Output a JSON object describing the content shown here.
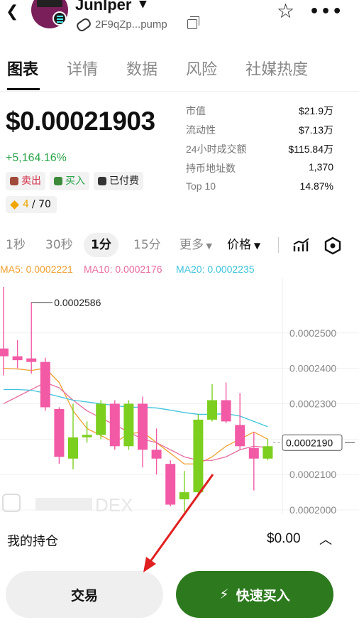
{
  "header": {
    "title": "JunIper",
    "address": "2F9qZp...pump",
    "icons": [
      "back-icon",
      "star-icon",
      "more-icon",
      "copy-icon",
      "pill-icon"
    ]
  },
  "tabs": [
    "图表",
    "详情",
    "数据",
    "风险",
    "社媒热度"
  ],
  "price": {
    "value": "$0.00021903",
    "change": "+5,164.16%"
  },
  "tags": {
    "sell": "卖出",
    "buy": "买入",
    "paid": "已付费",
    "rank": "4",
    "rank_total": "/ 70"
  },
  "stats": [
    {
      "k": "市值",
      "v": "$21.9万"
    },
    {
      "k": "流动性",
      "v": "$7.13万"
    },
    {
      "k": "24小时成交额",
      "v": "$115.84万"
    },
    {
      "k": "持币地址数",
      "v": "1,370"
    },
    {
      "k": "Top 10",
      "v": "14.87%"
    }
  ],
  "intervals": {
    "s1": "1秒",
    "s30": "30秒",
    "m1": "1分",
    "m15": "15分",
    "more": "更多",
    "price": "价格"
  },
  "chart_data": {
    "type": "candlestick",
    "ma_labels": {
      "ma5": "MA5: 0.0002221",
      "ma10": "MA10: 0.0002176",
      "ma20": "MA20: 0.0002235"
    },
    "y_ticks": [
      "0.0002500",
      "0.0002400",
      "0.0002300",
      "0.0002200",
      "0.0002100",
      "0.0002000"
    ],
    "y_tick_values": [
      0.00025,
      0.00024,
      0.00023,
      0.00022,
      0.00021,
      0.0002
    ],
    "ylim": [
      0.0001988,
      0.0002654
    ],
    "high_label": "0.0002586",
    "high_value": 0.0002586,
    "current_label": "0.0002190",
    "current_value": 0.000219,
    "candles": [
      {
        "o": 0.0002456,
        "c": 0.0002434,
        "h": 0.000263,
        "l": 0.000238
      },
      {
        "o": 0.0002434,
        "c": 0.0002423,
        "h": 0.000248,
        "l": 0.00024
      },
      {
        "o": 0.0002428,
        "c": 0.0002418,
        "h": 0.0002586,
        "l": 0.0002385
      },
      {
        "o": 0.0002418,
        "c": 0.000229,
        "h": 0.000243,
        "l": 0.000228
      },
      {
        "o": 0.0002285,
        "c": 0.000215,
        "h": 0.000229,
        "l": 0.000213
      },
      {
        "o": 0.0002145,
        "c": 0.0002205,
        "h": 0.00023,
        "l": 0.0002115
      },
      {
        "o": 0.0002205,
        "c": 0.0002212,
        "h": 0.000225,
        "l": 0.000219
      },
      {
        "o": 0.0002212,
        "c": 0.00023,
        "h": 0.000231,
        "l": 0.00022
      },
      {
        "o": 0.00023,
        "c": 0.000218,
        "h": 0.000231,
        "l": 0.000217
      },
      {
        "o": 0.000218,
        "c": 0.00023,
        "h": 0.000231,
        "l": 0.000217
      },
      {
        "o": 0.00023,
        "c": 0.000217,
        "h": 0.000232,
        "l": 0.000212
      },
      {
        "o": 0.000217,
        "c": 0.0002145,
        "h": 0.000223,
        "l": 0.00021
      },
      {
        "o": 0.000213,
        "c": 0.0002015,
        "h": 0.000214,
        "l": 0.000201
      },
      {
        "o": 0.000203,
        "c": 0.000205,
        "h": 0.000211,
        "l": 0.0001995
      },
      {
        "o": 0.000205,
        "c": 0.0002255,
        "h": 0.000227,
        "l": 0.000204
      },
      {
        "o": 0.0002255,
        "c": 0.000231,
        "h": 0.0002355,
        "l": 0.000225
      },
      {
        "o": 0.000231,
        "c": 0.000225,
        "h": 0.000236,
        "l": 0.0002245
      },
      {
        "o": 0.000224,
        "c": 0.000218,
        "h": 0.000233,
        "l": 0.000217
      },
      {
        "o": 0.0002175,
        "c": 0.0002145,
        "h": 0.000222,
        "l": 0.0002055
      },
      {
        "o": 0.0002145,
        "c": 0.000218,
        "h": 0.00022,
        "l": 0.000214
      }
    ],
    "ma_series": [
      {
        "key": "ma5",
        "color": "#f0a030",
        "values": [
          0.00024,
          0.0002398,
          0.0002394,
          0.00024,
          0.000236,
          0.000228,
          0.000223,
          0.000221,
          0.000219,
          0.0002215,
          0.000222,
          0.000219,
          0.000216,
          0.000213,
          0.000213,
          0.000215,
          0.000218,
          0.00022,
          0.000222,
          0.00022
        ]
      },
      {
        "key": "ma10",
        "color": "#e86aa0",
        "values": [
          0.00023,
          0.000232,
          0.000234,
          0.000236,
          0.0002345,
          0.000231,
          0.000228,
          0.000226,
          0.000224,
          0.000222,
          0.00022,
          0.000219,
          0.000217,
          0.000215,
          0.000214,
          0.000214,
          0.000215,
          0.000217,
          0.000218,
          0.0002176
        ]
      },
      {
        "key": "ma20",
        "color": "#3fc4dc",
        "values": [
          0.000234,
          0.000234,
          0.0002338,
          0.000233,
          0.000232,
          0.000231,
          0.0002305,
          0.00023,
          0.0002295,
          0.000229,
          0.000229,
          0.0002288,
          0.0002282,
          0.0002275,
          0.000227,
          0.000227,
          0.0002272,
          0.0002265,
          0.000225,
          0.0002235
        ]
      }
    ],
    "watermark": "DEX"
  },
  "colors": {
    "up": "#7ccf1f",
    "down": "#f25aa6",
    "accent_green": "#2d7a1e",
    "change_green": "#2aa54a",
    "sell_red": "#d4324a"
  },
  "holdings": {
    "label": "我的持仓",
    "value": "$0.00"
  },
  "actions": {
    "trade": "交易",
    "quick_buy": "快速买入"
  }
}
